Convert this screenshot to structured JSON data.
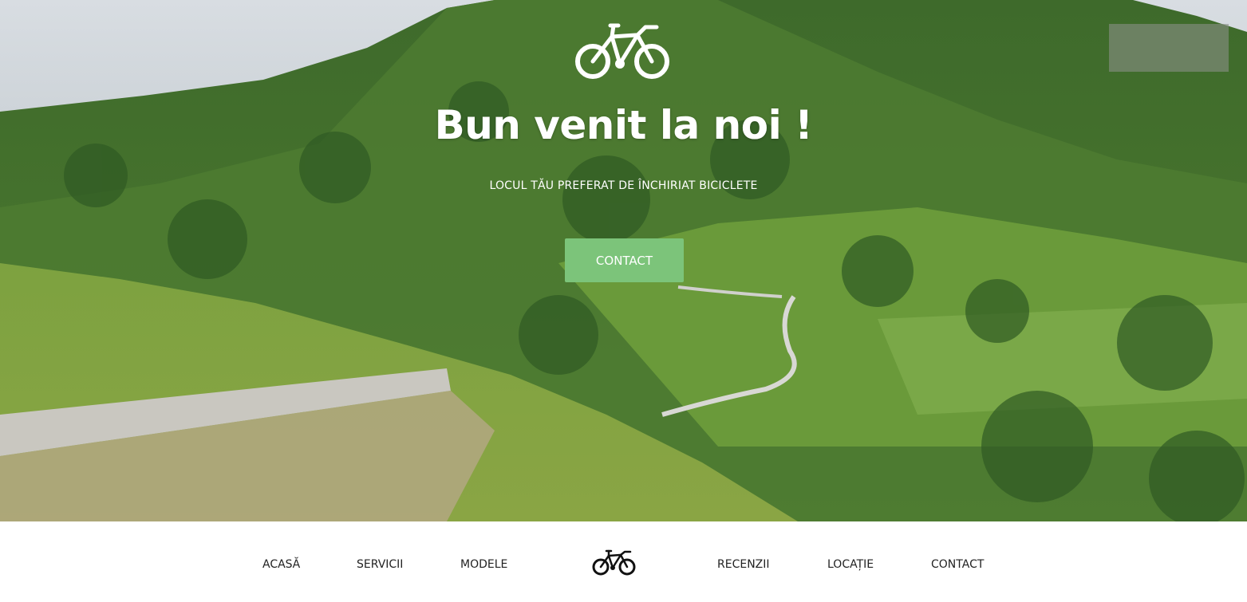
{
  "hero": {
    "logo_icon": "bicycle-icon",
    "title": "Bun venit la noi !",
    "subtitle": "LOCUL TĂU PREFERAT DE ÎNCHIRIAT BICICLETE",
    "cta_label": "CONTACT",
    "cta_color": "#7cc47a"
  },
  "nav": {
    "items": [
      {
        "label": "ACASĂ"
      },
      {
        "label": "SERVICII"
      },
      {
        "label": "MODELE"
      },
      {
        "label": "RECENZII"
      },
      {
        "label": "LOCAȚIE"
      },
      {
        "label": "CONTACT"
      }
    ],
    "logo_icon": "bicycle-icon"
  }
}
